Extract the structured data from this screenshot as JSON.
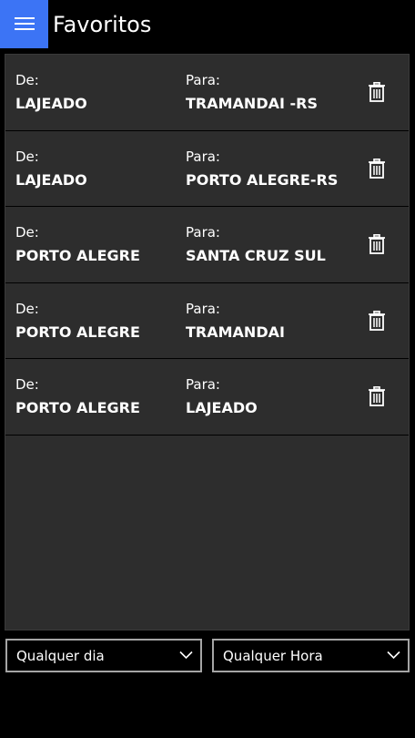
{
  "header": {
    "title": "Favoritos",
    "menu_icon": "hamburger-icon"
  },
  "favorites": [
    {
      "from_label": "De:",
      "from": "LAJEADO",
      "to_label": "Para:",
      "to": "TRAMANDAI -RS",
      "delete_icon": "trash-icon"
    },
    {
      "from_label": "De:",
      "from": "LAJEADO",
      "to_label": "Para:",
      "to": "PORTO ALEGRE-RS",
      "delete_icon": "trash-icon"
    },
    {
      "from_label": "De:",
      "from": "PORTO ALEGRE",
      "to_label": "Para:",
      "to": "SANTA CRUZ SUL",
      "delete_icon": "trash-icon"
    },
    {
      "from_label": "De:",
      "from": "PORTO ALEGRE",
      "to_label": "Para:",
      "to": "TRAMANDAI",
      "delete_icon": "trash-icon"
    },
    {
      "from_label": "De:",
      "from": "PORTO ALEGRE",
      "to_label": "Para:",
      "to": "LAJEADO",
      "delete_icon": "trash-icon"
    }
  ],
  "filters": {
    "day": "Qualquer dia",
    "hour": "Qualquer Hora"
  },
  "colors": {
    "accent": "#3c74f5",
    "panel": "#2d2d2d",
    "background": "#000000"
  }
}
